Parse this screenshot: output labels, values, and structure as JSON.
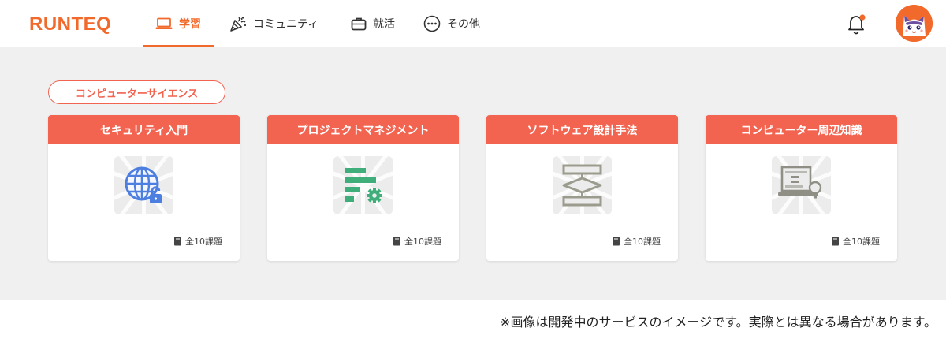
{
  "brand": {
    "logo_text": "RUNTEQ",
    "accent": "#f26a2b",
    "card_accent": "#f26350"
  },
  "nav": {
    "items": [
      {
        "label": "学習",
        "icon": "laptop-icon",
        "active": true
      },
      {
        "label": "コミュニティ",
        "icon": "party-popper-icon",
        "active": false
      },
      {
        "label": "就活",
        "icon": "briefcase-icon",
        "active": false
      },
      {
        "label": "その他",
        "icon": "more-dots-icon",
        "active": false
      }
    ]
  },
  "header": {
    "notification_icon": "bell-icon",
    "notification_badge_color": "#f26a2b",
    "avatar_icon": "cat-avatar-icon"
  },
  "main": {
    "category": "コンピューターサイエンス",
    "courses": [
      {
        "title": "セキュリティ入門",
        "icon": "globe-lock-icon",
        "count": "全10課題"
      },
      {
        "title": "プロジェクトマネジメント",
        "icon": "gantt-gear-icon",
        "count": "全10課題"
      },
      {
        "title": "ソフトウェア設計手法",
        "icon": "flowchart-icon",
        "count": "全10課題"
      },
      {
        "title": "コンピューター周辺知識",
        "icon": "binary-laptop-bulb-icon",
        "count": "全10課題"
      }
    ]
  },
  "footer_note": "※画像は開発中のサービスのイメージです。実際とは異なる場合があります。"
}
